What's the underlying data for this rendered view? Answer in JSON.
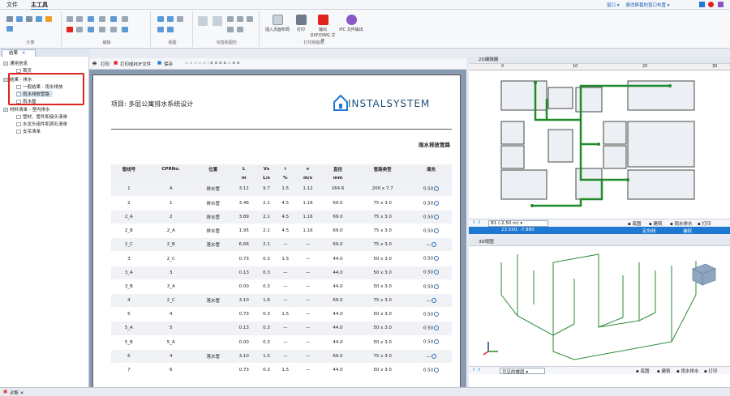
{
  "menubar": {
    "file": "文件",
    "main_tools": "主工具",
    "right_links": [
      "窗口 ▾",
      "更改屏幕的窗口布置 ▾"
    ]
  },
  "ribbon": {
    "groups": [
      "计算",
      "编辑",
      "视图",
      "标签和图形",
      "打印和输出"
    ],
    "buttons": {
      "insert_page_layout": "插入页面布局",
      "print": "打印",
      "export_dxf_dwg": "输出 DXF/DWG 文件",
      "ifc_export": "IFC 文件输出"
    }
  },
  "tab": {
    "label": "结果"
  },
  "tree": {
    "items": [
      {
        "label": "通用信息",
        "level": 0
      },
      {
        "label": "首页",
        "level": 1
      },
      {
        "label": "结果 - 排水",
        "level": 0
      },
      {
        "label": "一般结果 - 雨水排放",
        "level": 1
      },
      {
        "label": "雨水排放管路",
        "level": 1
      },
      {
        "label": "雨水屋",
        "level": 1
      },
      {
        "label": "材料清单 - 室内排水",
        "level": 0
      },
      {
        "label": "管材、管件和接头清单",
        "level": 1
      },
      {
        "label": "水龙头组件和洞孔清单",
        "level": 1
      },
      {
        "label": "支吊清单",
        "level": 1
      }
    ]
  },
  "doc_toolbar": {
    "print": "打印",
    "print_pdf": "打印成PDF文件",
    "save": "保存"
  },
  "document": {
    "project_title": "项目: 多层公寓排水系统设计",
    "logo": "INSTALSYSTEM",
    "section_title": "雨水排放管路",
    "headers": [
      "管线号",
      "CPRNo.",
      "位置",
      "L",
      "Vs",
      "i",
      "v",
      "直径",
      "管路类型",
      "填充"
    ],
    "units": [
      "",
      "",
      "",
      "m",
      "L/s",
      "%",
      "m/s",
      "mm",
      "",
      ""
    ],
    "rows": [
      [
        "1",
        "A",
        "排水管",
        "3.11",
        "9.7",
        "1.5",
        "1.12",
        "164.6",
        "200 x 7.7",
        "0.50"
      ],
      [
        "2",
        "1",
        "排水管",
        "3.46",
        "2.1",
        "4.5",
        "1.16",
        "69.0",
        "75 x 3.0",
        "0.50"
      ],
      [
        "2_A",
        "2",
        "排水管",
        "3.89",
        "2.1",
        "4.5",
        "1.16",
        "69.0",
        "75 x 3.0",
        "0.50"
      ],
      [
        "2_B",
        "2_A",
        "排水管",
        "1.95",
        "2.1",
        "4.5",
        "1.16",
        "69.0",
        "75 x 3.0",
        "0.50"
      ],
      [
        "2_C",
        "2_B",
        "落水管",
        "6.66",
        "2.1",
        "—",
        "—",
        "69.0",
        "75 x 3.0",
        "—"
      ],
      [
        "3",
        "2_C",
        "",
        "0.73",
        "0.3",
        "1.5",
        "—",
        "44.0",
        "50 x 3.0",
        "0.50"
      ],
      [
        "3_A",
        "3",
        "",
        "0.13",
        "0.3",
        "—",
        "—",
        "44.0",
        "50 x 3.0",
        "0.50"
      ],
      [
        "3_B",
        "3_A",
        "",
        "0.00",
        "0.3",
        "—",
        "—",
        "44.0",
        "50 x 3.0",
        "0.50"
      ],
      [
        "4",
        "2_C",
        "落水管",
        "3.10",
        "1.8",
        "—",
        "—",
        "69.0",
        "75 x 3.0",
        "—"
      ],
      [
        "5",
        "4",
        "",
        "0.73",
        "0.3",
        "1.5",
        "—",
        "44.0",
        "50 x 3.0",
        "0.50"
      ],
      [
        "5_A",
        "5",
        "",
        "0.13",
        "0.3",
        "—",
        "—",
        "44.0",
        "50 x 3.0",
        "0.50"
      ],
      [
        "5_B",
        "5_A",
        "",
        "0.00",
        "0.3",
        "—",
        "—",
        "44.0",
        "50 x 3.0",
        "0.50"
      ],
      [
        "6",
        "4",
        "落水管",
        "3.10",
        "1.5",
        "—",
        "—",
        "69.0",
        "75 x 3.0",
        "—"
      ],
      [
        "7",
        "6",
        "",
        "0.73",
        "0.3",
        "1.5",
        "—",
        "44.0",
        "50 x 3.0",
        "0.50"
      ]
    ]
  },
  "view2d": {
    "title": "2D编辑器",
    "ruler": [
      "0",
      "10",
      "20",
      "30"
    ],
    "floor": "B1 (-2.50 m)",
    "coords": "23.550; -7.880",
    "status_items": [
      "定向线",
      "捕捉"
    ],
    "toolbar_items": [
      "底图",
      "建筑",
      "雨水排水",
      "打印"
    ]
  },
  "view3d": {
    "title": "3D视图",
    "visible_floors": "可见的楼层",
    "toolbar_items": [
      "底图",
      "建筑",
      "雨水排水",
      "打印"
    ]
  },
  "statusbar": {
    "label": "诊断 ✕"
  },
  "colors": {
    "accent": "#1f78d1",
    "pipe": "#1f8a2a",
    "highlight": "#e0241c"
  }
}
